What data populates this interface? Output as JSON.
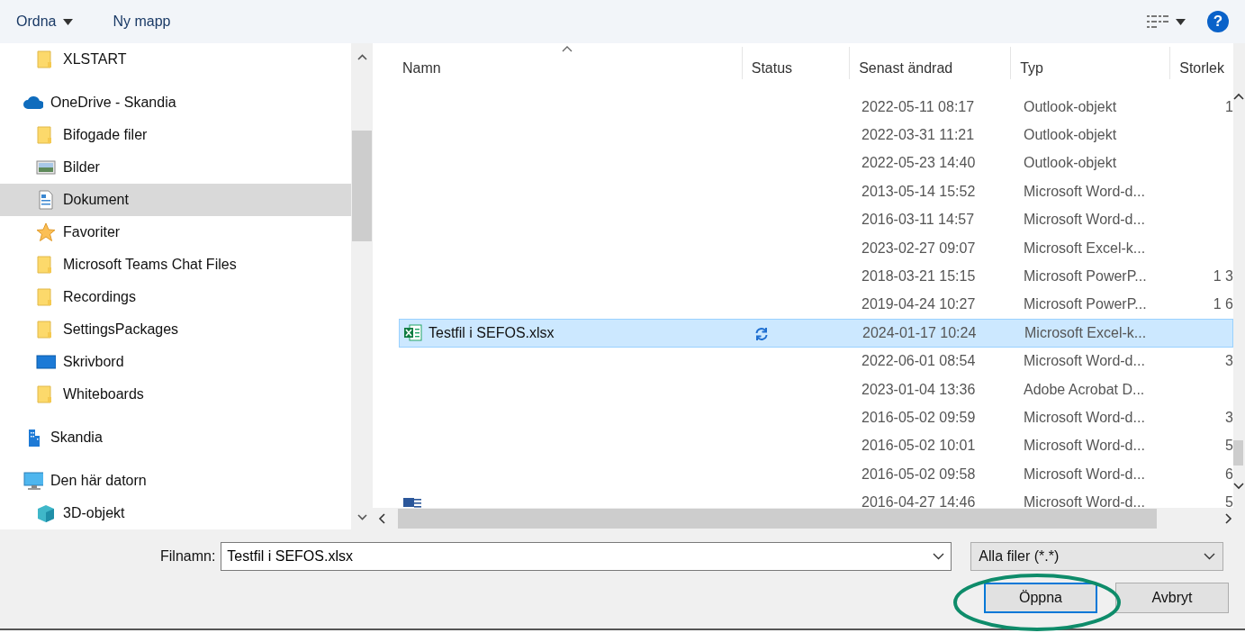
{
  "toolbar": {
    "organize": "Ordna",
    "new_folder": "Ny mapp",
    "help": "?"
  },
  "sidebar": {
    "sections": [
      {
        "children": [
          {
            "label": "XLSTART",
            "kind": "folder",
            "selected": false
          }
        ]
      },
      {
        "label": "OneDrive - Skandia",
        "kind": "cloud",
        "selected": false,
        "children": [
          {
            "label": "Bifogade filer",
            "kind": "folder",
            "selected": false
          },
          {
            "label": "Bilder",
            "kind": "pictures",
            "selected": false
          },
          {
            "label": "Dokument",
            "kind": "documents",
            "selected": true
          },
          {
            "label": "Favoriter",
            "kind": "star",
            "selected": false
          },
          {
            "label": "Microsoft Teams Chat Files",
            "kind": "folder",
            "selected": false
          },
          {
            "label": "Recordings",
            "kind": "folder",
            "selected": false
          },
          {
            "label": "SettingsPackages",
            "kind": "folder",
            "selected": false
          },
          {
            "label": "Skrivbord",
            "kind": "desktop",
            "selected": false
          },
          {
            "label": "Whiteboards",
            "kind": "folder",
            "selected": false
          }
        ]
      },
      {
        "label": "Skandia",
        "kind": "building",
        "selected": false
      },
      {
        "label": "Den här datorn",
        "kind": "computer",
        "selected": false,
        "children": [
          {
            "label": "3D-objekt",
            "kind": "cube",
            "selected": false
          }
        ]
      }
    ]
  },
  "file_list": {
    "columns": [
      {
        "label": "Namn",
        "sorted": true
      },
      {
        "label": "Status",
        "sorted": false
      },
      {
        "label": "Senast ändrad",
        "sorted": false
      },
      {
        "label": "Typ",
        "sorted": false
      },
      {
        "label": "Storlek",
        "sorted": false
      }
    ],
    "rows": [
      {
        "modified": "2022-05-11 08:17",
        "type": "Outlook-objekt",
        "size": "1",
        "selected": false
      },
      {
        "modified": "2022-03-31 11:21",
        "type": "Outlook-objekt",
        "selected": false
      },
      {
        "modified": "2022-05-23 14:40",
        "type": "Outlook-objekt",
        "selected": false
      },
      {
        "modified": "2013-05-14 15:52",
        "type": "Microsoft Word-d...",
        "selected": false
      },
      {
        "modified": "2016-03-11 14:57",
        "type": "Microsoft Word-d...",
        "selected": false
      },
      {
        "modified": "2023-02-27 09:07",
        "type": "Microsoft Excel-k...",
        "selected": false
      },
      {
        "modified": "2018-03-21 15:15",
        "type": "Microsoft PowerP...",
        "size": "1 3",
        "selected": false
      },
      {
        "modified": "2019-04-24 10:27",
        "type": "Microsoft PowerP...",
        "size": "1 6",
        "selected": false
      },
      {
        "kind": "excel",
        "name": "Testfil i SEFOS.xlsx",
        "syncing": true,
        "modified": "2024-01-17 10:24",
        "type": "Microsoft Excel-k...",
        "selected": true
      },
      {
        "modified": "2022-06-01 08:54",
        "type": "Microsoft Word-d...",
        "size": "3",
        "selected": false
      },
      {
        "modified": "2023-01-04 13:36",
        "type": "Adobe Acrobat D...",
        "selected": false
      },
      {
        "modified": "2016-05-02 09:59",
        "type": "Microsoft Word-d...",
        "size": "3",
        "selected": false
      },
      {
        "modified": "2016-05-02 10:01",
        "type": "Microsoft Word-d...",
        "size": "5",
        "selected": false
      },
      {
        "modified": "2016-05-02 09:58",
        "type": "Microsoft Word-d...",
        "size": "6",
        "selected": false
      },
      {
        "kind": "word",
        "modified": "2016-04-27 14:46",
        "type": "Microsoft Word-d...",
        "size": "5",
        "selected": false
      }
    ]
  },
  "footer": {
    "filename_label": "Filnamn:",
    "filename": "Testfil i SEFOS.xlsx",
    "filter": "Alla filer (*.*)",
    "buttons": [
      {
        "label": "Öppna",
        "default": true
      },
      {
        "label": "Avbryt",
        "default": false
      }
    ],
    "highlight": true
  }
}
